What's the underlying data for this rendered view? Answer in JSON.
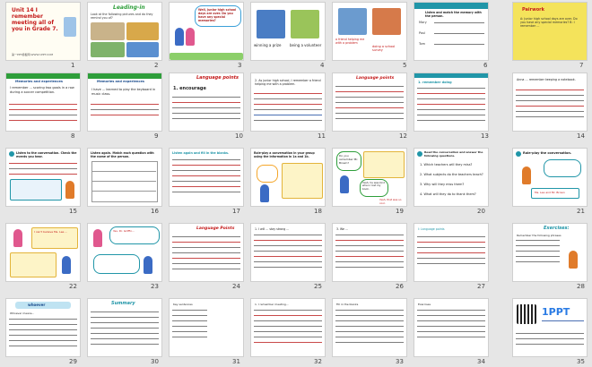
{
  "colors": {
    "background": "#e6e6e6",
    "slide_border": "#cfcfcf",
    "title_blue": "#1a4b8c",
    "title_red": "#c41a1a",
    "accent_green": "#2e9e3a",
    "accent_teal": "#1aa3b5",
    "accent_yellow": "#f4e35b"
  },
  "slides": [
    {
      "n": 1,
      "title": "Unit 14 I remember meeting all of you in Grade 7.",
      "subtitle": "第一PPT模板网-WWW.1PPT.COM"
    },
    {
      "n": 2,
      "title": "Leading-in",
      "subtitle": "Look at the following pictures and do they remind you of?"
    },
    {
      "n": 3,
      "title": "Well, junior high school days are over. Do you have any special memories?"
    },
    {
      "n": 4,
      "caption1": "winning a prize",
      "caption2": "being a volunteer"
    },
    {
      "n": 5,
      "caption1": "a friend helping me with a problem",
      "caption2": "doing a school survey"
    },
    {
      "n": 6,
      "title": "Listen and match the memory with the person.",
      "names": [
        "Mary",
        "Paul",
        "Tom"
      ]
    },
    {
      "n": 7,
      "title": "Pairwork",
      "text": "A: Junior high school days are over. Do you have any special memories? B: I remember ..."
    },
    {
      "n": 8,
      "title": "Memories and experiences",
      "text": "I remember ... scoring two goals in a row during a soccer competition."
    },
    {
      "n": 9,
      "title": "Memories and experiences",
      "text": "I have ... learned to play the keyboard in music class."
    },
    {
      "n": 10,
      "title": "Language points",
      "text": "1. encourage"
    },
    {
      "n": 11,
      "text": "2. As junior high school, I remember a friend helping me with a problem."
    },
    {
      "n": 12,
      "title": "Language points"
    },
    {
      "n": 13,
      "text": "1. remember doing"
    },
    {
      "n": 14,
      "text": "Anna ... remember keeping a notebook."
    },
    {
      "n": 15,
      "title": "Listen to the conversation. Check the events you hear."
    },
    {
      "n": 16,
      "title": "Listen again. Match each question with the name of the person."
    },
    {
      "n": 17,
      "title": "Listen again and fill in the blanks."
    },
    {
      "n": 18,
      "title": "Role-play a conversation in your group using the information in 1a and 1b."
    },
    {
      "n": 19,
      "bubble1": "Do you remember Mr. Brown?",
      "bubble2": "Yeah, he was kind when I lost my book.",
      "bubble3": "Yeah, that was so cool."
    },
    {
      "n": 20,
      "title": "Read the conversation and answer the following questions.",
      "questions": [
        "1. Which teachers will they miss?",
        "2. What subjects do the teachers teach?",
        "3. Why will they miss them?",
        "4. What will they do to thank them?"
      ]
    },
    {
      "n": 21,
      "title": "Role-play the conversation.",
      "text": "Ms. Lee and Mr. Brown"
    },
    {
      "n": 22,
      "text": "I can't believe Ms. Lee ..."
    },
    {
      "n": 23,
      "text": "Yes, Dr. Griffin..."
    },
    {
      "n": 24,
      "title": "Language Points"
    },
    {
      "n": 25,
      "text": "1. I will ... stay strong ..."
    },
    {
      "n": 26,
      "text": "3. We ..."
    },
    {
      "n": 27,
      "text": "I: Language points"
    },
    {
      "n": 28,
      "title": "Exercises:",
      "text": "Remember the following phrases"
    },
    {
      "n": 29,
      "title": "whoever",
      "text": "Whoever means..."
    },
    {
      "n": 30,
      "title": "Summary"
    },
    {
      "n": 31,
      "text": "Key sentences"
    },
    {
      "n": 32,
      "text": "1. I remember meeting..."
    },
    {
      "n": 33,
      "text": "Fill in the blanks"
    },
    {
      "n": 34,
      "text": "Exercises"
    },
    {
      "n": 35,
      "logo": "1PPT"
    },
    {
      "n": 36,
      "items": [
        "1. Recite the conversation in 2d.",
        "2. Finish the exercises in the workbook."
      ]
    }
  ]
}
